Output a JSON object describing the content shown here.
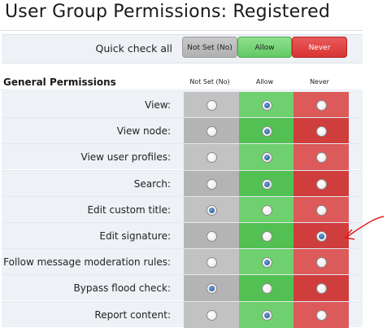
{
  "page": {
    "title": "User Group Permissions: Registered"
  },
  "quick_check": {
    "label": "Quick check all",
    "buttons": {
      "not_set": "Not Set (No)",
      "allow": "Allow",
      "never": "Never"
    }
  },
  "section": {
    "title": "General Permissions",
    "columns": {
      "not_set": "Not Set (No)",
      "allow": "Allow",
      "never": "Never"
    }
  },
  "permissions": [
    {
      "label": "View:",
      "value": "allow"
    },
    {
      "label": "View node:",
      "value": "allow"
    },
    {
      "label": "View user profiles:",
      "value": "allow"
    },
    {
      "label": "Search:",
      "value": "allow"
    },
    {
      "label": "Edit custom title:",
      "value": "not_set"
    },
    {
      "label": "Edit signature:",
      "value": "never"
    },
    {
      "label": "Follow message moderation rules:",
      "value": "allow"
    },
    {
      "label": "Bypass flood check:",
      "value": "not_set"
    },
    {
      "label": "Report content:",
      "value": "allow"
    }
  ],
  "colors": {
    "not_set": "#b4b4b4",
    "allow": "#52c052",
    "never": "#cf3d3d",
    "annotation": "#e02020"
  }
}
